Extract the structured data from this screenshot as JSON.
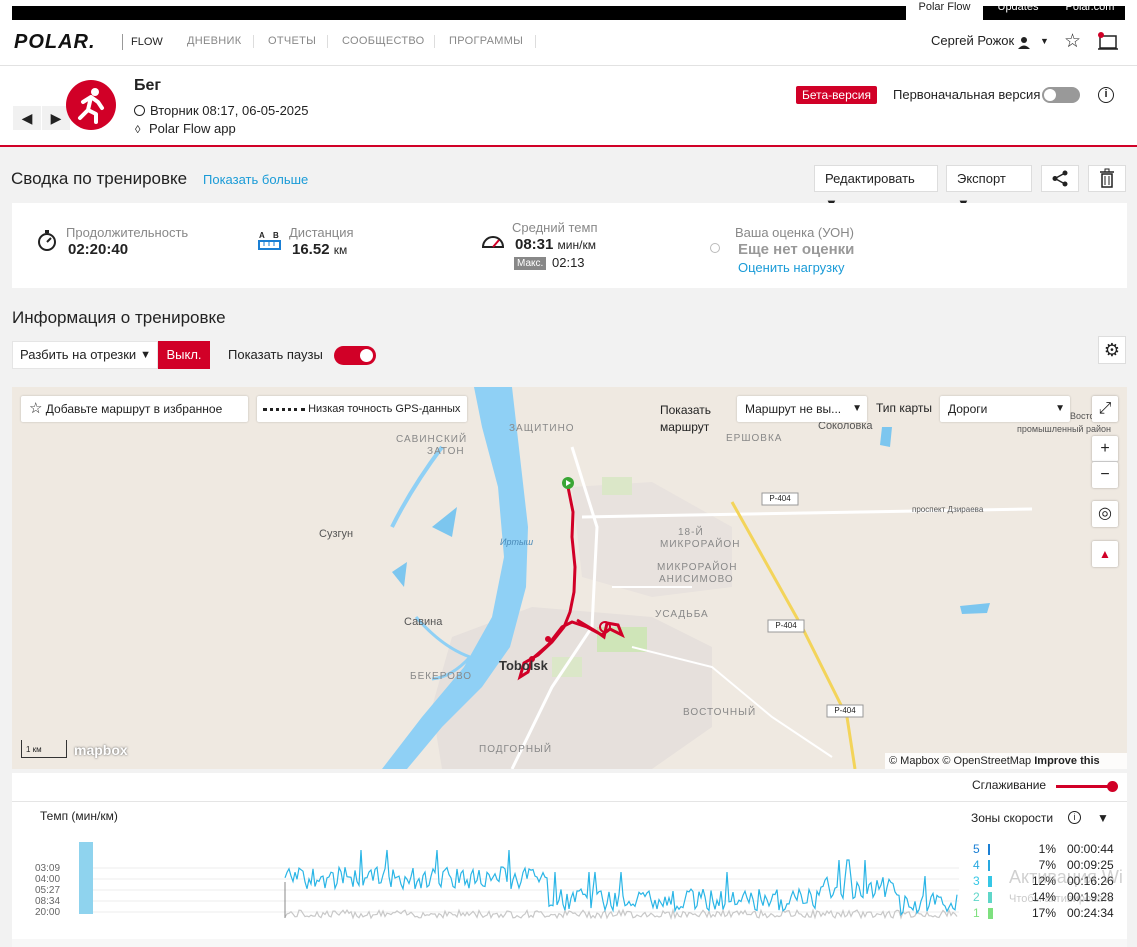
{
  "top": {
    "tabs": [
      "Polar Flow",
      "Updates",
      "Polar.com"
    ]
  },
  "header": {
    "logo": "POLAR.",
    "product": "FLOW",
    "nav": [
      "ДНЕВНИК",
      "ОТЧЕТЫ",
      "СООБЩЕСТВО",
      "ПРОГРАММЫ"
    ],
    "user": "Сергей Рожок"
  },
  "session": {
    "sport": "Бег",
    "datetime": "Вторник 08:17, 06-05-2025",
    "source": "Polar Flow app",
    "beta": "Бета-версия",
    "original": "Первоначальная версия"
  },
  "summary": {
    "title": "Сводка по тренировке",
    "show_more": "Показать больше",
    "edit": "Редактировать",
    "export": "Экспорт"
  },
  "stats": {
    "duration_label": "Продолжительность",
    "duration": "02:20:40",
    "distance_label": "Дистанция",
    "distance": "16.52",
    "distance_unit": "км",
    "pace_label": "Средний темп",
    "pace": "08:31",
    "pace_unit": "мин/км",
    "max_label": "Макс.",
    "max_pace": "02:13",
    "rpe_label": "Ваша оценка (УОН)",
    "rpe_value": "Еще нет оценки",
    "rpe_link": "Оценить нагрузку"
  },
  "info": {
    "title": "Информация о тренировке",
    "split": "Разбить на отрезки",
    "off": "Выкл.",
    "pauses": "Показать паузы"
  },
  "map": {
    "favorite": "Добавьте маршрут в избранное",
    "gps": "Низкая точность GPS-данных",
    "show_route_1": "Показать",
    "show_route_2": "маршрут",
    "route_select": "Маршрут не вы...",
    "map_type_label": "Тип карты",
    "map_type": "Дороги",
    "attribution": "© Mapbox © OpenStreetMap",
    "improve": "Improve this map",
    "scale": "1 км",
    "mapbox": "mapbox",
    "labels": {
      "savinsky": "САВИНСКИЙ",
      "zaton": "ЗАТОН",
      "zashchitino": "ЗАЩИТИНО",
      "ershovka": "ЕРШОВКА",
      "sokolovka": "Соколовка",
      "prom1": "Восточный",
      "prom2": "промышленный район",
      "suzgun": "Сузгун",
      "irtysh": "Иртыш",
      "mr18a": "18-Й",
      "mr18b": "МИКРОРАЙОН",
      "anis1": "МИКРОРАЙОН",
      "anis2": "АНИСИМОВО",
      "usadba": "УСАДЬБА",
      "savina": "Савина",
      "tobolsk": "Tobolsk",
      "bekerovo": "БЕКЕРОВО",
      "vostochny": "ВОСТОЧНЫЙ",
      "podgorny": "ПОДГОРНЫЙ",
      "p404": "Р-404",
      "prospekt": "проспект Дзираева"
    }
  },
  "chart": {
    "smoothing": "Сглаживание",
    "title": "Темп (мин/км)",
    "zones_title": "Зоны скорости",
    "yticks": [
      "03:09",
      "04:00",
      "05:27",
      "08:34",
      "20:00"
    ],
    "zones": [
      {
        "n": "5",
        "pct": "1%",
        "time": "00:00:44",
        "color": "#1a7fd4",
        "frac": 0.01
      },
      {
        "n": "4",
        "pct": "7%",
        "time": "00:09:25",
        "color": "#28a8e0",
        "frac": 0.07
      },
      {
        "n": "3",
        "pct": "12%",
        "time": "00:16:26",
        "color": "#35c7e6",
        "frac": 0.12
      },
      {
        "n": "2",
        "pct": "14%",
        "time": "00:19:28",
        "color": "#5fd6c9",
        "frac": 0.14
      },
      {
        "n": "1",
        "pct": "17%",
        "time": "00:24:34",
        "color": "#7ee07f",
        "frac": 0.17
      }
    ],
    "watermark1": "Активация Wi",
    "watermark2": "Чтобы активировать"
  }
}
